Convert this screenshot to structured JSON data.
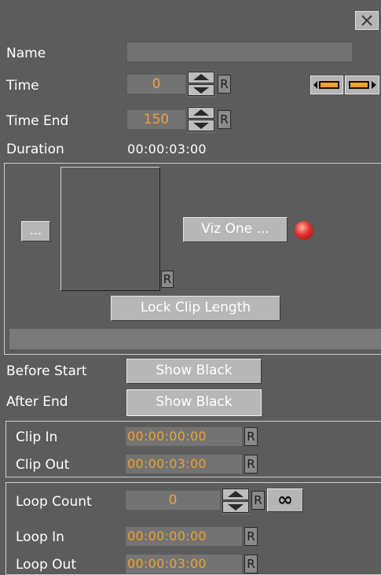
{
  "name_label": "Name",
  "name_value": "",
  "time": {
    "label": "Time",
    "value": "0",
    "r": "R"
  },
  "time_end": {
    "label": "Time End",
    "value": "150",
    "r": "R"
  },
  "duration": {
    "label": "Duration",
    "value": "00:00:03:00"
  },
  "clip": {
    "browse_button": "...",
    "vizone_button": "Viz One ...",
    "r": "R",
    "lock_button": "Lock Clip Length"
  },
  "before_start": {
    "label": "Before Start",
    "value": "Show Black"
  },
  "after_end": {
    "label": "After End",
    "value": "Show Black"
  },
  "clip_in": {
    "label": "Clip In",
    "value": "00:00:00:00",
    "r": "R"
  },
  "clip_out": {
    "label": "Clip Out",
    "value": "00:00:03:00",
    "r": "R"
  },
  "loop_count": {
    "label": "Loop Count",
    "value": "0",
    "r": "R",
    "infinite_glyph": "∞"
  },
  "loop_in": {
    "label": "Loop In",
    "value": "00:00:00:00",
    "r": "R"
  },
  "loop_out": {
    "label": "Loop Out",
    "value": "00:00:03:00",
    "r": "R"
  },
  "colors": {
    "background": "#5c5c5c",
    "accent": "#f2a12c",
    "field": "#737373",
    "status_led": "#e03030"
  },
  "icons": {
    "close": "close-icon",
    "spin": "spin-updown-icon",
    "nav": [
      "step-left-icon",
      "step-right-icon"
    ],
    "led": "status-led-icon"
  }
}
